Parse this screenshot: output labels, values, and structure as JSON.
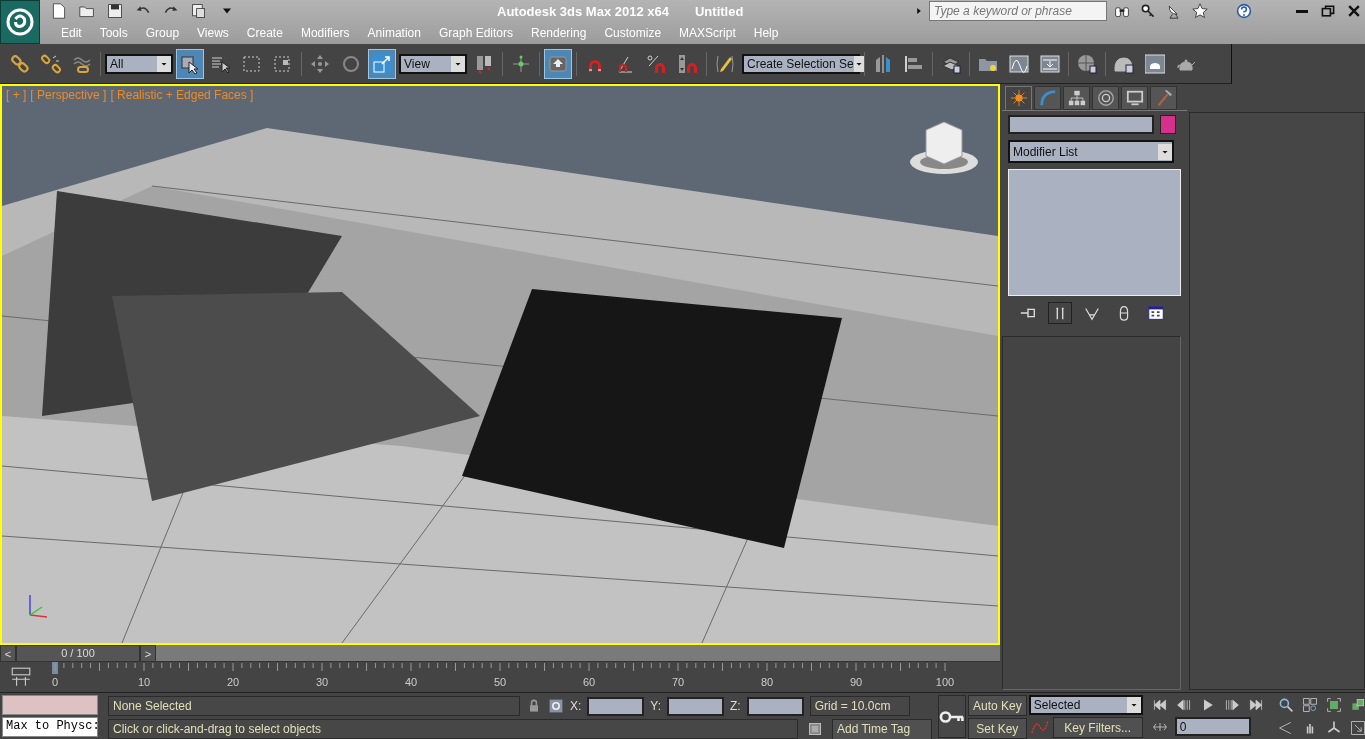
{
  "title_bar": {
    "app_title": "Autodesk 3ds Max  2012 x64",
    "document": "Untitled",
    "search": {
      "placeholder": "Type a keyword or phrase"
    }
  },
  "menu": [
    "Edit",
    "Tools",
    "Group",
    "Views",
    "Create",
    "Modifiers",
    "Animation",
    "Graph Editors",
    "Rendering",
    "Customize",
    "MAXScript",
    "Help"
  ],
  "toolbar": {
    "groups": [
      [
        {
          "kind": "button",
          "selected": false
        },
        {
          "kind": "button",
          "selected": false
        },
        {
          "kind": "button",
          "selected": false
        }
      ],
      [
        {
          "kind": "dropdown",
          "value": "All"
        },
        {
          "kind": "button",
          "selected": true
        },
        {
          "kind": "button",
          "selected": false
        },
        {
          "kind": "button",
          "selected": false
        },
        {
          "kind": "button",
          "selected": false
        }
      ],
      [
        {
          "kind": "button",
          "selected": false
        },
        {
          "kind": "button",
          "selected": false
        },
        {
          "kind": "button",
          "selected": true
        },
        {
          "kind": "dropdown",
          "value": "View"
        },
        {
          "kind": "button",
          "selected": false
        }
      ],
      [
        {
          "kind": "button",
          "selected": false
        }
      ],
      [
        {
          "kind": "button",
          "selected": true
        }
      ],
      [
        {
          "kind": "button",
          "selected": false
        },
        {
          "kind": "button",
          "selected": false
        },
        {
          "kind": "button",
          "selected": false
        },
        {
          "kind": "button",
          "selected": false
        }
      ],
      [
        {
          "kind": "button",
          "selected": false
        },
        {
          "kind": "dropdown",
          "value": "Create Selection Se"
        }
      ],
      [
        {
          "kind": "button",
          "selected": false
        },
        {
          "kind": "button",
          "selected": false
        }
      ],
      [
        {
          "kind": "button",
          "selected": false
        }
      ],
      [
        {
          "kind": "button",
          "selected": false
        },
        {
          "kind": "button",
          "selected": false
        },
        {
          "kind": "button",
          "selected": false
        }
      ],
      [
        {
          "kind": "button",
          "selected": false
        }
      ],
      [
        {
          "kind": "button",
          "selected": false
        },
        {
          "kind": "button",
          "selected": false
        },
        {
          "kind": "button",
          "selected": false
        }
      ]
    ]
  },
  "viewport": {
    "labels": [
      "[ + ]",
      "[ Perspective ]",
      "[ Realistic + Edged Faces ]"
    ]
  },
  "command_panel": {
    "tabs": [
      {
        "selected": true
      },
      {
        "selected": false
      },
      {
        "selected": false
      },
      {
        "selected": false
      },
      {
        "selected": false
      },
      {
        "selected": false
      }
    ],
    "modifier_list": "Modifier List",
    "stack_buttons": [
      {
        "selected": false
      },
      {
        "selected": true
      },
      {
        "selected": false
      },
      {
        "selected": false
      },
      {
        "selected": false
      }
    ]
  },
  "time_slider": {
    "prev": "<",
    "position": "0 / 100",
    "next": ">"
  },
  "track_bar": {
    "ticks": [
      "0",
      "10",
      "20",
      "30",
      "40",
      "50",
      "60",
      "70",
      "80",
      "90",
      "100"
    ]
  },
  "status_bar": {
    "listener": "Max to Physc:",
    "selection": "None Selected",
    "prompt": "Click or click-and-drag to select objects",
    "coords": [
      "X:",
      "Y:",
      "Z:"
    ],
    "grid": "Grid = 10.0cm",
    "add_time_tag": "Add Time Tag",
    "auto_key": "Auto Key",
    "set_key": "Set Key",
    "key_mode": "Selected",
    "key_filters": "Key Filters...",
    "frame": "0"
  }
}
